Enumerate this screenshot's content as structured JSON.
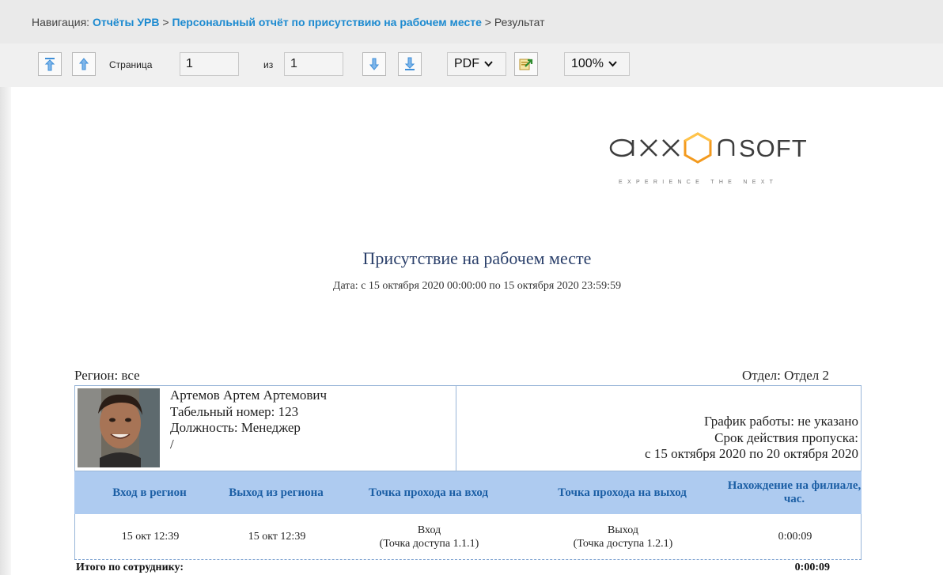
{
  "nav": {
    "prefix": "Навигация:",
    "link1": "Отчёты УРВ",
    "sep1": ">",
    "link2": "Персональный отчёт по присутствию на рабочем месте",
    "sep2": ">",
    "current": "Результат"
  },
  "toolbar": {
    "page_label": "Страница",
    "page_value": "1",
    "of_label": "из",
    "total_pages": "1",
    "format": "PDF",
    "zoom": "100%",
    "icons": [
      "first-page-icon",
      "prev-page-icon",
      "next-page-icon",
      "last-page-icon",
      "export-icon",
      "chevron-down-icon"
    ]
  },
  "report": {
    "logo_text": "axxonsoft",
    "logo_tagline": "EXPERIENCE THE NEXT",
    "title": "Присутствие на рабочем месте",
    "date": "Дата: с 15 октября 2020 00:00:00 по 15 октября 2020 23:59:59",
    "region": "Регион: все",
    "department": "Отдел: Отдел 2",
    "employee": {
      "name": "Артемов Артем Артемович",
      "number": "Табельный номер: 123",
      "position": "Должность: Менеджер",
      "extra": "/",
      "schedule": "График работы: не указано",
      "pass_label": "Срок действия пропуска:",
      "pass_period": "с 15 октября 2020 по 20 октября 2020"
    },
    "columns": [
      "Вход в регион",
      "Выход из региона",
      "Точка прохода на вход",
      "Точка прохода на выход",
      "Нахождение на филиале, час."
    ],
    "rows": [
      {
        "entry": "15 окт 12:39",
        "exit": "15 окт 12:39",
        "in_point": "Вход",
        "in_point_detail": "(Точка доступа 1.1.1)",
        "out_point": "Выход",
        "out_point_detail": "(Точка доступа 1.2.1)",
        "duration": "0:00:09"
      }
    ],
    "total_label": "Итого по сотруднику:",
    "total_value": "0:00:09"
  }
}
